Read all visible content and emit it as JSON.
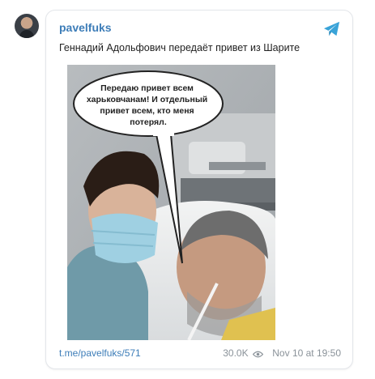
{
  "post": {
    "channel_name": "pavelfuks",
    "caption": "Геннадий Адольфович передаёт привет из Шарите",
    "photo_speech_bubble": "Передаю привет всем харьковчанам! И отдельный привет всем, кто меня потерял.",
    "link": "t.me/pavelfuks/571",
    "views": "30.0K",
    "timestamp": "Nov 10 at 19:50"
  },
  "icons": {
    "telegram": "telegram-icon",
    "views": "eye-icon"
  },
  "colors": {
    "link_blue": "#3d7db8",
    "telegram_blue": "#39a3d8",
    "meta_gray": "#8a9299"
  }
}
